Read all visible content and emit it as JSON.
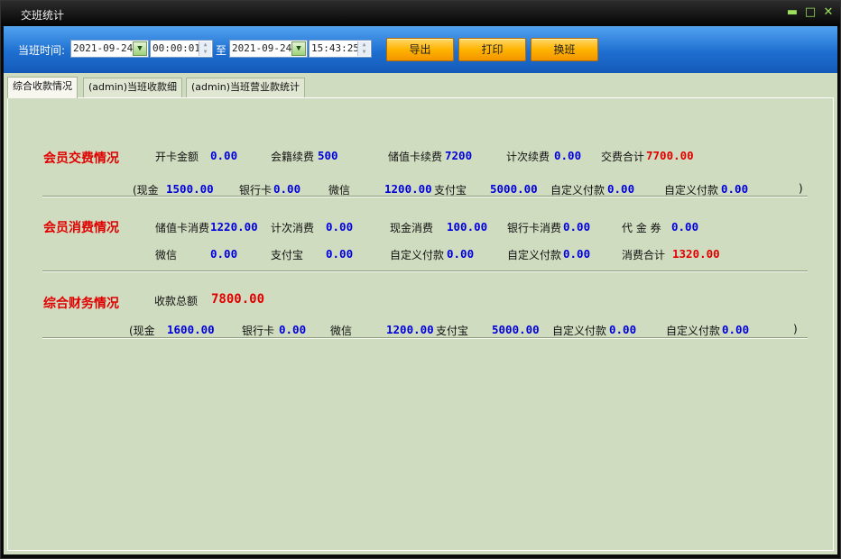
{
  "window": {
    "title": "交班统计",
    "controls": {
      "minimize": "▬",
      "maximize": "□",
      "close": "✕"
    }
  },
  "toolbar": {
    "shift_time_label": "当班时间:",
    "start_date": "2021-09-24",
    "start_time": "00:00:01",
    "to_label": "至",
    "end_date": "2021-09-24",
    "end_time": "15:43:25",
    "buttons": {
      "export": "导出",
      "print": "打印",
      "handover": "换班"
    }
  },
  "tabs": [
    {
      "label": "综合收款情况",
      "active": true
    },
    {
      "label": "(admin)当班收款细",
      "active": false
    },
    {
      "label": "(admin)当班营业款统计",
      "active": false
    }
  ],
  "member_payment": {
    "heading": "会员交费情况",
    "open_card_label": "开卡金额",
    "open_card_value": "0.00",
    "renewal_label": "会籍续费",
    "renewal_value": "500",
    "stored_card_label": "储值卡续费",
    "stored_card_value": "7200",
    "count_renewal_label": "计次续费",
    "count_renewal_value": "0.00",
    "total_label": "交费合计",
    "total_value": "7700.00",
    "breakdown": {
      "open_paren": "(现金",
      "cash_value": "1500.00",
      "bank_label": "银行卡",
      "bank_value": "0.00",
      "wechat_label": "微信",
      "wechat_value": "1200.00",
      "alipay_label": "支付宝",
      "alipay_value": "5000.00",
      "custom1_label": "自定义付款",
      "custom1_value": "0.00",
      "custom2_label": "自定义付款",
      "custom2_value": "0.00",
      "close_paren": ")"
    }
  },
  "member_consumption": {
    "heading": "会员消费情况",
    "stored_card_label": "储值卡消费",
    "stored_card_value": "1220.00",
    "count_label": "计次消费",
    "count_value": "0.00",
    "cash_label": "现金消费",
    "cash_value": "100.00",
    "bank_label": "银行卡消费",
    "bank_value": "0.00",
    "voucher_label": "代 金 券",
    "voucher_value": "0.00",
    "wechat_label": "微信",
    "wechat_value": "0.00",
    "alipay_label": "支付宝",
    "alipay_value": "0.00",
    "custom1_label": "自定义付款",
    "custom1_value": "0.00",
    "custom2_label": "自定义付款",
    "custom2_value": "0.00",
    "total_label": "消费合计",
    "total_value": "1320.00"
  },
  "finance": {
    "heading": "综合财务情况",
    "total_label": "收款总额",
    "total_value": "7800.00",
    "breakdown": {
      "open_paren": "(现金",
      "cash_value": "1600.00",
      "bank_label": "银行卡",
      "bank_value": "0.00",
      "wechat_label": "微信",
      "wechat_value": "1200.00",
      "alipay_label": "支付宝",
      "alipay_value": "5000.00",
      "custom1_label": "自定义付款",
      "custom1_value": "0.00",
      "custom2_label": "自定义付款",
      "custom2_value": "0.00",
      "close_paren": ")"
    }
  },
  "colors": {
    "accent_red": "#e00000",
    "value_blue": "#0000dd",
    "panel_bg": "#d0dcc0",
    "toolbar_blue": "#1e6fd0",
    "button_orange": "#ffb400"
  }
}
